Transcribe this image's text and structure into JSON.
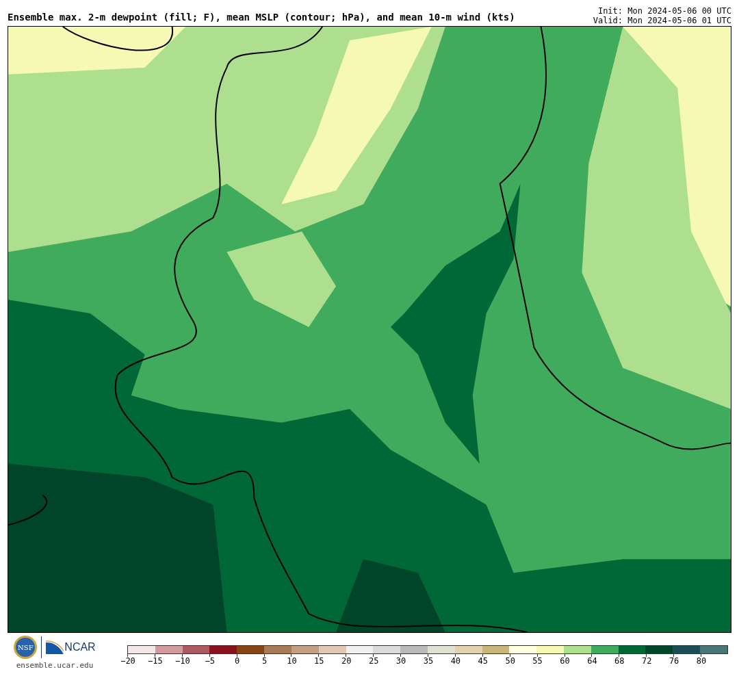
{
  "header": {
    "title": "Ensemble max. 2-m dewpoint (fill; F), mean MSLP (contour; hPa), and mean 10-m wind (kts)",
    "init": "Init: Mon 2024-05-06 00 UTC",
    "valid": "Valid: Mon 2024-05-06 01 UTC"
  },
  "footer": {
    "logo_nsf": "NSF",
    "logo_ncar": "NCAR",
    "url": "ensemble.ucar.edu"
  },
  "colorbar": {
    "bins": [
      {
        "color": "#f3e6e7"
      },
      {
        "color": "#d09a9e"
      },
      {
        "color": "#ac5a60"
      },
      {
        "color": "#8a121e"
      },
      {
        "color": "#874514"
      },
      {
        "color": "#a87a56"
      },
      {
        "color": "#c49e82"
      },
      {
        "color": "#e0c8b4"
      },
      {
        "color": "#efefef"
      },
      {
        "color": "#dadada"
      },
      {
        "color": "#b9b9b9"
      },
      {
        "color": "#e0e0d2"
      },
      {
        "color": "#e3d2ae"
      },
      {
        "color": "#cab67b"
      },
      {
        "color": "#ffffe0"
      },
      {
        "color": "#f5f9b4"
      },
      {
        "color": "#addf8e"
      },
      {
        "color": "#41ab5d"
      },
      {
        "color": "#006837"
      },
      {
        "color": "#004529"
      },
      {
        "color": "#1b4f55"
      },
      {
        "color": "#4a7676"
      }
    ],
    "ticks": [
      "−20",
      "−15",
      "−10",
      "−5",
      "0",
      "5",
      "10",
      "15",
      "20",
      "25",
      "30",
      "35",
      "40",
      "45",
      "50",
      "55",
      "60",
      "64",
      "68",
      "72",
      "76",
      "80"
    ]
  }
}
